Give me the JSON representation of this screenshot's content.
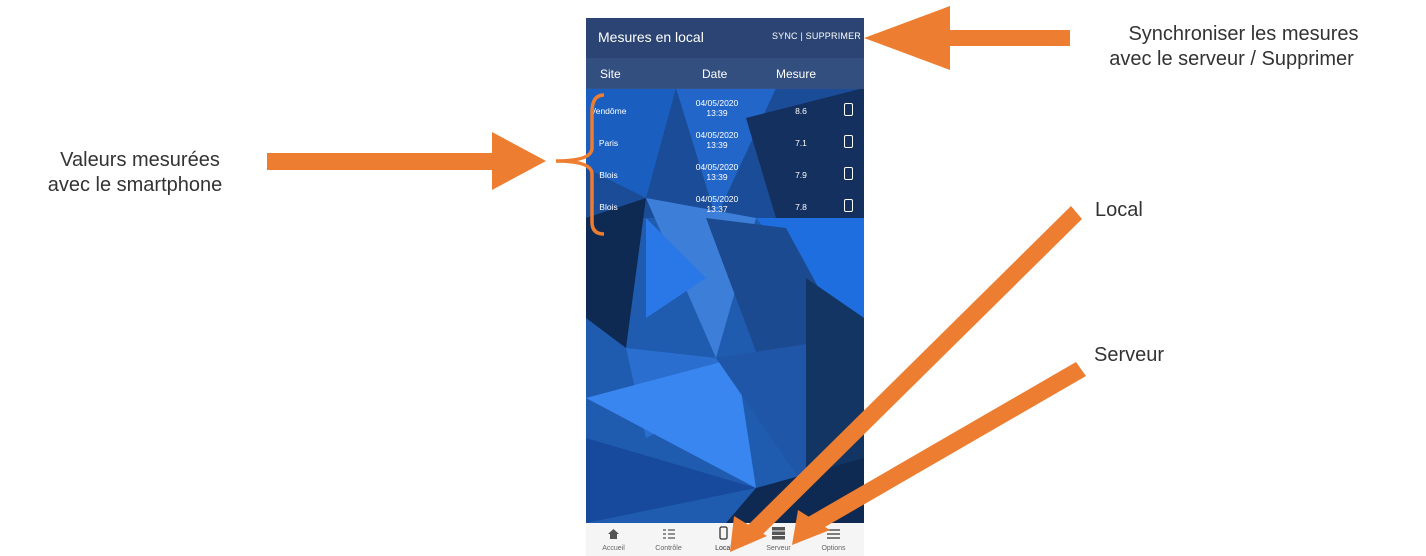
{
  "app": {
    "title": "Mesures en local",
    "actions": "SYNC | SUPPRIMER",
    "columns": [
      "Site",
      "Date",
      "Mesure"
    ],
    "rows": [
      {
        "site": "Vendôme",
        "date": "04/05/2020",
        "time": "13:39",
        "value": "8.6"
      },
      {
        "site": "Paris",
        "date": "04/05/2020",
        "time": "13:39",
        "value": "7.1"
      },
      {
        "site": "Blois",
        "date": "04/05/2020",
        "time": "13:39",
        "value": "7.9"
      },
      {
        "site": "Blois",
        "date": "04/05/2020",
        "time": "13:37",
        "value": "7.8"
      }
    ],
    "tabs": [
      {
        "label": "Accueil",
        "icon": "home-icon"
      },
      {
        "label": "Contrôle",
        "icon": "checklist-icon"
      },
      {
        "label": "Local",
        "icon": "smartphone-icon"
      },
      {
        "label": "Serveur",
        "icon": "server-icon"
      },
      {
        "label": "Options",
        "icon": "menu-icon"
      }
    ]
  },
  "annotations": {
    "sync": [
      "Synchroniser les mesures",
      "avec le serveur / Supprimer"
    ],
    "values": [
      "Valeurs mesurées",
      "avec le smartphone"
    ],
    "local": "Local",
    "server": "Serveur"
  },
  "colors": {
    "accent": "#ed7d31",
    "appbar": "#2b4473",
    "background": "#1a4f9a"
  }
}
